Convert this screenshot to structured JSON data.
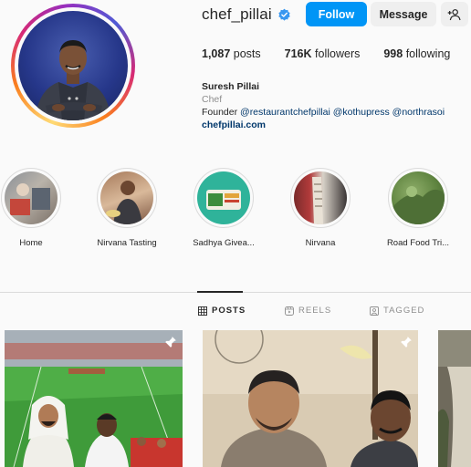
{
  "profile": {
    "username": "chef_pillai",
    "verified": true,
    "follow_label": "Follow",
    "message_label": "Message",
    "posts_count": "1,087",
    "posts_label": "posts",
    "followers_count": "716K",
    "followers_label": "followers",
    "following_count": "998",
    "following_label": "following",
    "display_name": "Suresh Pillai",
    "category": "Chef",
    "bio_prefix": "Founder ",
    "bio_mentions": "@restaurantchefpillai @kothupress @northrasoi",
    "bio_link": "chefpillai.com"
  },
  "highlights": [
    {
      "label": "Home"
    },
    {
      "label": "Nirvana Tasting"
    },
    {
      "label": "Sadhya Givea..."
    },
    {
      "label": "Nirvana"
    },
    {
      "label": "Road Food Tri..."
    }
  ],
  "tabs": {
    "posts": "POSTS",
    "reels": "REELS",
    "tagged": "TAGGED"
  },
  "colors": {
    "accent": "#0095f6",
    "verified": "#3897f0"
  }
}
